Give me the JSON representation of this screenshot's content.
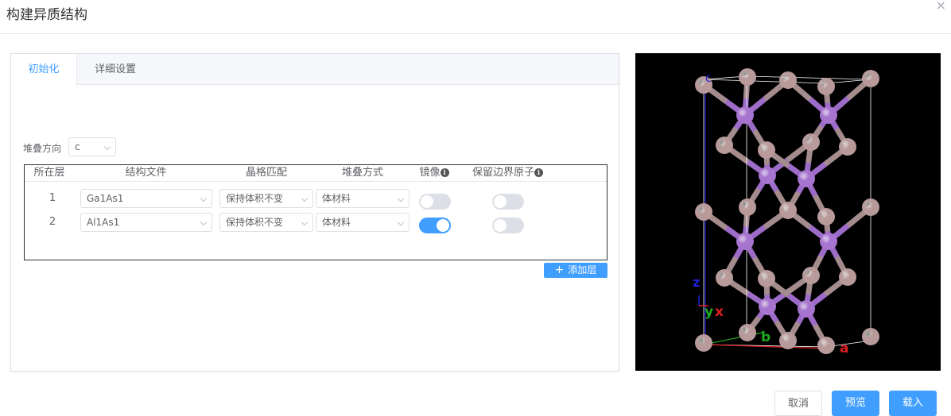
{
  "dialog": {
    "title": "构建异质结构",
    "close": "×"
  },
  "tabs": [
    {
      "label": "初始化",
      "active": true
    },
    {
      "label": "详细设置",
      "active": false
    }
  ],
  "stack_direction": {
    "label": "堆叠方向",
    "value": "c"
  },
  "table": {
    "headers": [
      "所在层",
      "结构文件",
      "晶格匹配",
      "堆叠方式",
      "镜像",
      "保留边界原子"
    ],
    "rows": [
      {
        "layer": "1",
        "file": "Ga1As1",
        "lattice": "保持体积不变",
        "stack": "体材料",
        "mirror": false,
        "keep_boundary": false
      },
      {
        "layer": "2",
        "file": "Al1As1",
        "lattice": "保持体积不变",
        "stack": "体材料",
        "mirror": true,
        "keep_boundary": false
      }
    ]
  },
  "add_layer": {
    "icon": "+",
    "label": "添加层"
  },
  "viewer": {
    "axis_labels": {
      "c": "c",
      "z": "z",
      "y": "y",
      "x": "x",
      "b": "b",
      "a": "a"
    },
    "colors": {
      "gray_atom": "#b89a9a",
      "purple_atom": "#a774cf",
      "bond_gray": "#a48c8c",
      "bond_purple": "#9d6cc8",
      "axis_blue": "#1f1fe0",
      "axis_green": "#1faa1f",
      "axis_red": "#e01f1f"
    }
  },
  "footer": {
    "cancel": "取消",
    "preview": "预览",
    "load": "载入"
  },
  "theme": {
    "primary": "#409eff",
    "border": "#dcdfe6"
  }
}
